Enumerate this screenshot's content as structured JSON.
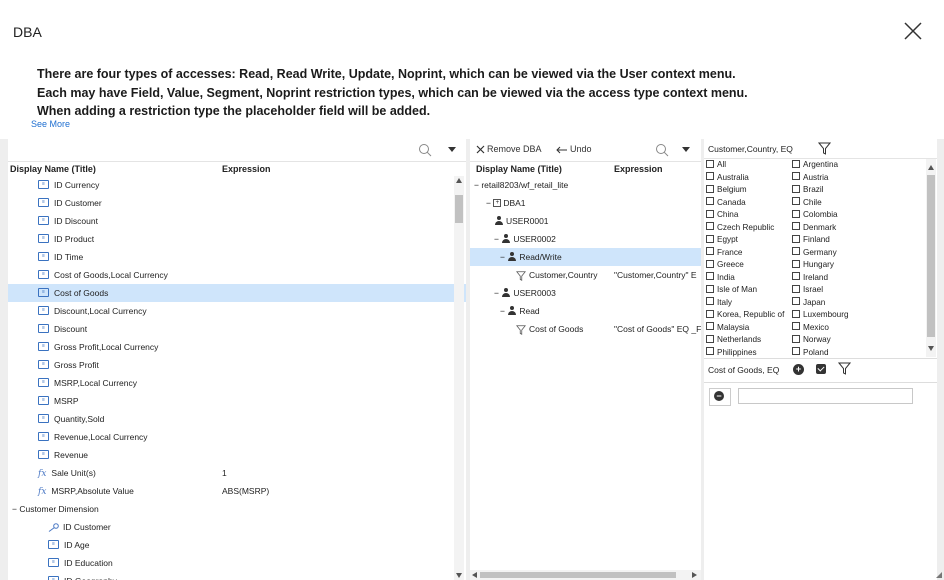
{
  "dialog": {
    "title": "DBA",
    "info_lines": [
      "There are four types of accesses: Read, Read Write, Update, Noprint, which can be viewed via the User context menu.",
      "Each may have Field, Value, Segment, Noprint restriction types, which can be viewed via the access type context menu.",
      "When adding a restriction type the placeholder field will be added."
    ],
    "see_more": "See More"
  },
  "fields_panel": {
    "col_display": "Display Name (Title)",
    "col_expression": "Expression",
    "rows": [
      {
        "label": "ID Currency",
        "expr": "",
        "type": "field",
        "indent": 1
      },
      {
        "label": "ID Customer",
        "expr": "",
        "type": "field",
        "indent": 1
      },
      {
        "label": "ID Discount",
        "expr": "",
        "type": "field",
        "indent": 1
      },
      {
        "label": "ID Product",
        "expr": "",
        "type": "field",
        "indent": 1
      },
      {
        "label": "ID Time",
        "expr": "",
        "type": "field",
        "indent": 1
      },
      {
        "label": "Cost of Goods,Local Currency",
        "expr": "",
        "type": "field",
        "indent": 1
      },
      {
        "label": "Cost of Goods",
        "expr": "",
        "type": "field",
        "indent": 1,
        "selected": true
      },
      {
        "label": "Discount,Local Currency",
        "expr": "",
        "type": "field",
        "indent": 1
      },
      {
        "label": "Discount",
        "expr": "",
        "type": "field",
        "indent": 1
      },
      {
        "label": "Gross Profit,Local Currency",
        "expr": "",
        "type": "field",
        "indent": 1
      },
      {
        "label": "Gross Profit",
        "expr": "",
        "type": "field",
        "indent": 1
      },
      {
        "label": "MSRP,Local Currency",
        "expr": "",
        "type": "field",
        "indent": 1
      },
      {
        "label": "MSRP",
        "expr": "",
        "type": "field",
        "indent": 1
      },
      {
        "label": "Quantity,Sold",
        "expr": "",
        "type": "field",
        "indent": 1
      },
      {
        "label": "Revenue,Local Currency",
        "expr": "",
        "type": "field",
        "indent": 1
      },
      {
        "label": "Revenue",
        "expr": "",
        "type": "field",
        "indent": 1
      },
      {
        "label": "Sale Unit(s)",
        "expr": "1",
        "type": "fx",
        "indent": 1
      },
      {
        "label": "MSRP,Absolute Value",
        "expr": "ABS(MSRP)",
        "type": "fx",
        "indent": 1
      },
      {
        "label": "Customer Dimension",
        "expr": "",
        "type": "group",
        "indent": 0
      },
      {
        "label": "ID Customer",
        "expr": "",
        "type": "key",
        "indent": 2
      },
      {
        "label": "ID Age",
        "expr": "",
        "type": "field",
        "indent": 2
      },
      {
        "label": "ID Education",
        "expr": "",
        "type": "field",
        "indent": 2
      },
      {
        "label": "ID Geography",
        "expr": "",
        "type": "field",
        "indent": 2
      }
    ]
  },
  "dba_panel": {
    "remove_label": "Remove DBA",
    "undo_label": "Undo",
    "col_display": "Display Name (Title)",
    "col_expression": "Expression",
    "rows": [
      {
        "label": "retail8203/wf_retail_lite",
        "expr": "",
        "type": "root",
        "indent": 0
      },
      {
        "label": "DBA1",
        "expr": "",
        "type": "dba",
        "indent": 1
      },
      {
        "label": "USER0001",
        "expr": "",
        "type": "user",
        "indent": 2
      },
      {
        "label": "USER0002",
        "expr": "",
        "type": "user-open",
        "indent": 2
      },
      {
        "label": "Read/Write",
        "expr": "",
        "type": "access",
        "indent": 3,
        "selected": true
      },
      {
        "label": "Customer,Country",
        "expr": "\"Customer,Country\" E",
        "type": "filter",
        "indent": 4
      },
      {
        "label": "USER0003",
        "expr": "",
        "type": "user-open",
        "indent": 2
      },
      {
        "label": "Read",
        "expr": "",
        "type": "access",
        "indent": 3
      },
      {
        "label": "Cost of Goods",
        "expr": "\"Cost of Goods\" EQ _F",
        "type": "filter",
        "indent": 4
      }
    ]
  },
  "values_panel": {
    "filter_label": "Customer,Country, EQ",
    "countries_left": [
      "All",
      "Australia",
      "Belgium",
      "Canada",
      "China",
      "Czech Republic",
      "Egypt",
      "France",
      "Greece",
      "India",
      "Isle of Man",
      "Italy",
      "Korea, Republic of",
      "Malaysia",
      "Netherlands",
      "Philippines"
    ],
    "countries_right": [
      "Argentina",
      "Austria",
      "Brazil",
      "Chile",
      "Colombia",
      "Denmark",
      "Finland",
      "Germany",
      "Hungary",
      "Ireland",
      "Israel",
      "Japan",
      "Luxembourg",
      "Mexico",
      "Norway",
      "Poland"
    ],
    "second_filter_label": "Cost of Goods, EQ",
    "value_input": ""
  }
}
